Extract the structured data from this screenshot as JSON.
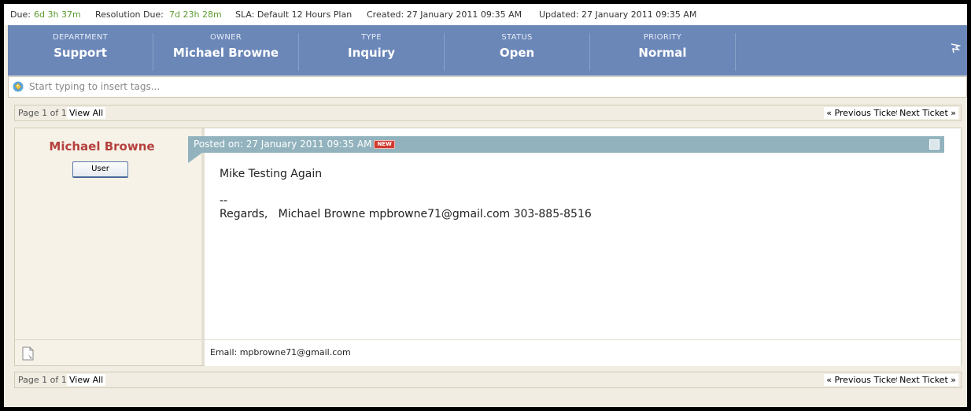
{
  "meta": {
    "due_label": "Due:",
    "due_value": "6d 3h 37m",
    "resolution_label": "Resolution Due:",
    "resolution_value": "7d 23h 28m",
    "sla": "SLA: Default 12 Hours Plan",
    "created": "Created: 27 January 2011 09:35 AM",
    "updated": "Updated: 27 January 2011 09:35 AM"
  },
  "props": [
    {
      "label": "DEPARTMENT",
      "value": "Support"
    },
    {
      "label": "OWNER",
      "value": "Michael Browne"
    },
    {
      "label": "TYPE",
      "value": "Inquiry"
    },
    {
      "label": "STATUS",
      "value": "Open"
    },
    {
      "label": "PRIORITY",
      "value": "Normal"
    }
  ],
  "tags": {
    "placeholder": "Start typing to insert tags..."
  },
  "pager": {
    "info": "Page 1 of 1",
    "view_all": "View All",
    "prev": "« Previous Ticket",
    "next": "Next Ticket »"
  },
  "post": {
    "author": "Michael Browne",
    "role": "User",
    "posted_on": "Posted on: 27 January 2011 09:35 AM",
    "new_badge": "NEW",
    "body": "Mike Testing Again\n\n--\nRegards,   Michael Browne mpbrowne71@gmail.com 303-885-8516",
    "footer_email": "Email: mpbrowne71@gmail.com"
  },
  "colors": {
    "props_bar": "#6b87b8",
    "author_name": "#b5403e",
    "posted_bar": "#92b3be",
    "due_green": "#5a9b2f"
  }
}
